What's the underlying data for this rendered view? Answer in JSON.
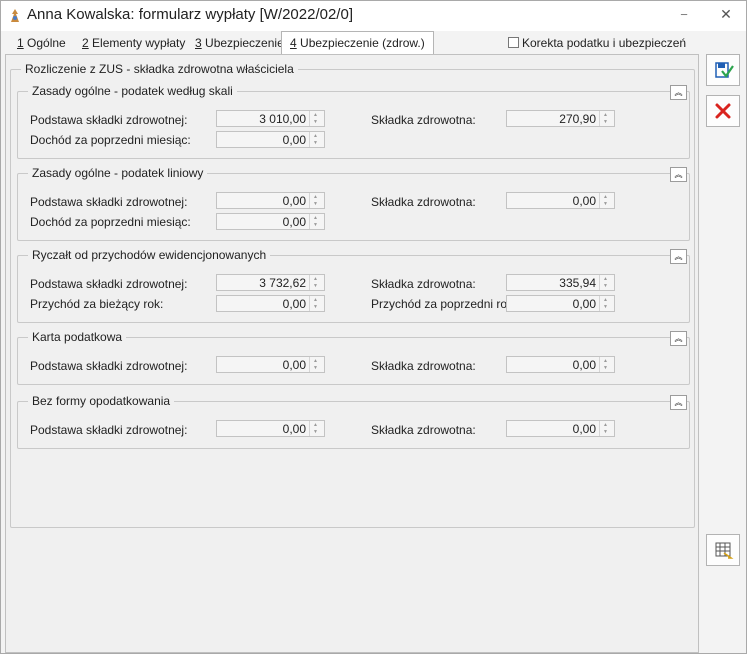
{
  "window": {
    "title": "Anna Kowalska: formularz wypłaty [W/2022/02/0]",
    "minimize_glyph": "−",
    "close_glyph": "✕"
  },
  "tabs": [
    {
      "num": "1",
      "label": " Ogólne"
    },
    {
      "num": "2",
      "label": " Elementy wypłaty"
    },
    {
      "num": "3",
      "label": " Ubezpieczenie"
    },
    {
      "num": "4",
      "label": " Ubezpieczenie (zdrow.)"
    }
  ],
  "correction_checkbox": {
    "label": "Korekta podatku i ubezpieczeń",
    "checked": false
  },
  "outer_group_title": "Rozliczenie z ZUS - składka zdrowotna właściciela",
  "groups": [
    {
      "title": "Zasady ogólne - podatek według skali",
      "left_label_1": "Podstawa składki zdrowotnej:",
      "left_value_1": "3 010,00",
      "left_label_2": "Dochód za poprzedni miesiąc:",
      "left_value_2": "0,00",
      "right_label_1": "Składka zdrowotna:",
      "right_value_1": "270,90"
    },
    {
      "title": "Zasady ogólne - podatek liniowy",
      "left_label_1": "Podstawa składki zdrowotnej:",
      "left_value_1": "0,00",
      "left_label_2": "Dochód za poprzedni miesiąc:",
      "left_value_2": "0,00",
      "right_label_1": "Składka zdrowotna:",
      "right_value_1": "0,00"
    },
    {
      "title": "Ryczałt od przychodów ewidencjonowanych",
      "left_label_1": "Podstawa składki zdrowotnej:",
      "left_value_1": "3 732,62",
      "left_label_2": "Przychód za bieżący rok:",
      "left_value_2": "0,00",
      "right_label_1": "Składka zdrowotna:",
      "right_value_1": "335,94",
      "right_label_2": "Przychód za poprzedni rok:",
      "right_value_2": "0,00"
    },
    {
      "title": "Karta podatkowa",
      "left_label_1": "Podstawa składki zdrowotnej:",
      "left_value_1": "0,00",
      "right_label_1": "Składka zdrowotna:",
      "right_value_1": "0,00"
    },
    {
      "title": "Bez formy opodatkowania",
      "left_label_1": "Podstawa składki zdrowotnej:",
      "left_value_1": "0,00",
      "right_label_1": "Składka zdrowotna:",
      "right_value_1": "0,00"
    }
  ],
  "colors": {
    "accept_icon": "#1f5fb5",
    "cancel_icon": "#d9231e",
    "accent": "#2e75d8"
  },
  "icons": [
    "save-accept-icon",
    "cancel-x-icon",
    "calculator-table-icon",
    "collapse-chevron-up-icon"
  ]
}
